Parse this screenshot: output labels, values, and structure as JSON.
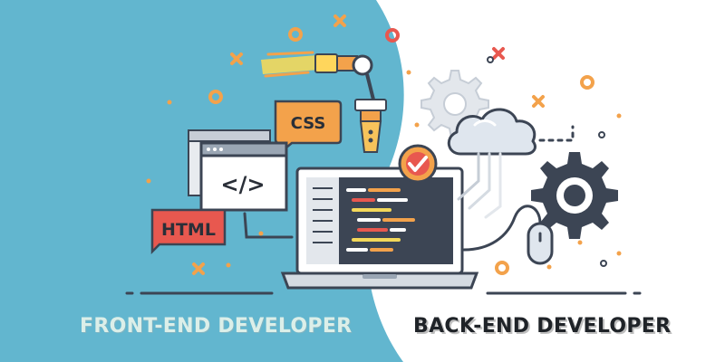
{
  "illustration": {
    "css_label": "CSS",
    "html_label": "HTML",
    "code_tag": "</>"
  },
  "captions": {
    "front_end": "FRONT-END DEVELOPER",
    "back_end": "BACK-END DEVELOPER"
  },
  "colors": {
    "front_end_background": "#62b6cf",
    "accent_orange": "#f3a24b",
    "accent_red": "#e8584f",
    "outline": "#3c4554"
  }
}
